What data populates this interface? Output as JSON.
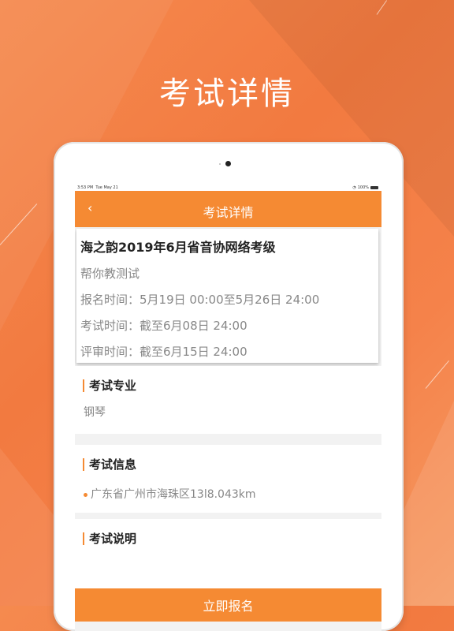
{
  "promo": {
    "title": "考试详情"
  },
  "status": {
    "time": "3:53 PM",
    "date": "Tue May 21",
    "battery": "100%"
  },
  "navbar": {
    "back_icon": "‹",
    "title": "考试详情"
  },
  "exam": {
    "name": "海之韵2019年6月省音协网络考级",
    "organizer": "帮你教测试",
    "registration": "报名时间：5月19日 00:00至5月26日 24:00",
    "exam_time": "考试时间：截至6月08日 24:00",
    "review_time": "评审时间：截至6月15日 24:00"
  },
  "sections": {
    "major": {
      "label": "考试专业",
      "value": "钢琴"
    },
    "info": {
      "label": "考试信息",
      "value": "广东省广州市海珠区13l8.043km"
    },
    "notes": {
      "label": "考试说明"
    }
  },
  "footer": {
    "signup_label": "立即报名"
  },
  "colors": {
    "accent": "#f58a33",
    "background": "#f27a40"
  }
}
